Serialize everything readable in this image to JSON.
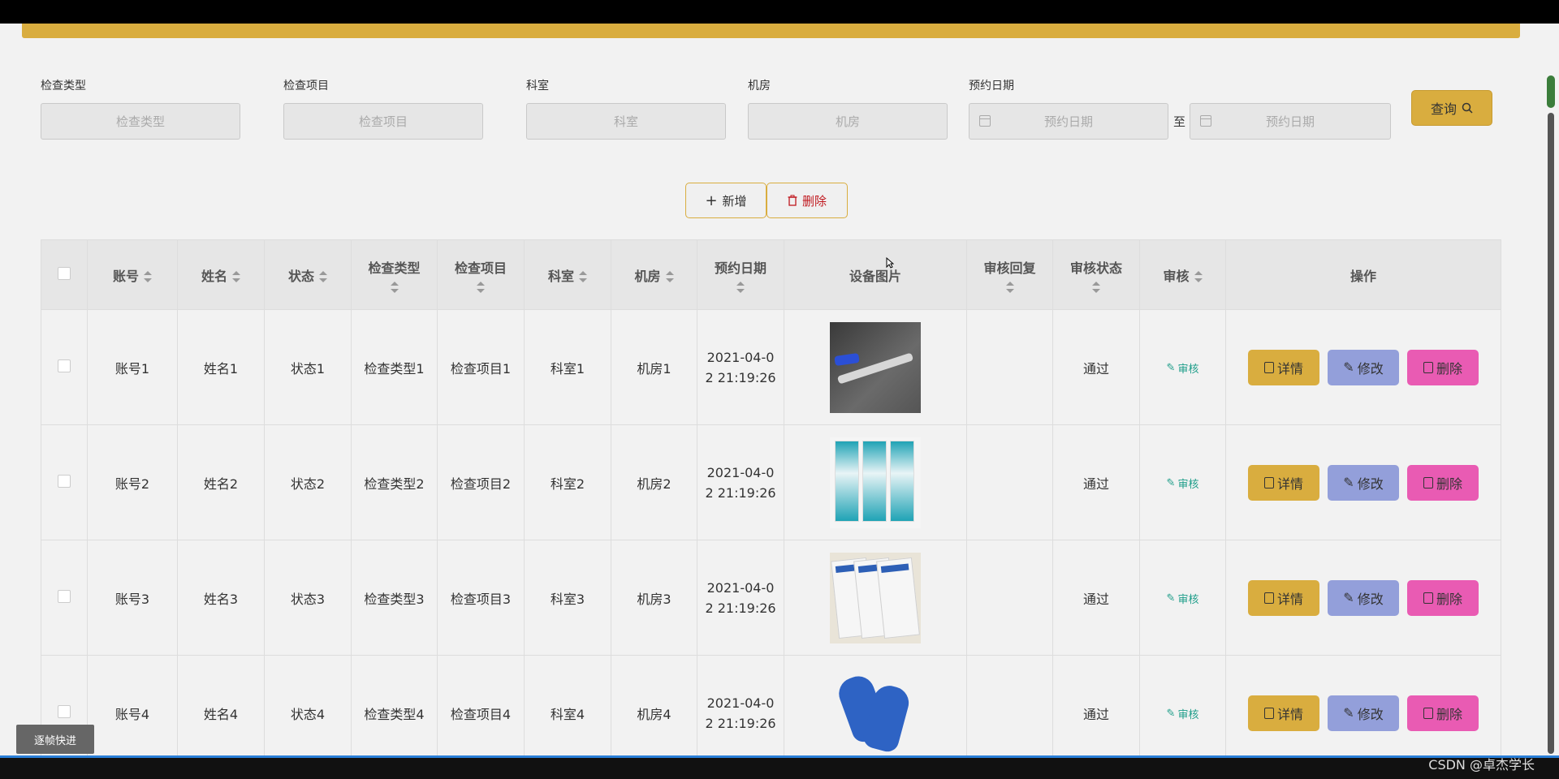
{
  "filters": [
    {
      "label": "检查类型",
      "placeholder": "检查类型"
    },
    {
      "label": "检查项目",
      "placeholder": "检查项目"
    },
    {
      "label": "科室",
      "placeholder": "科室"
    },
    {
      "label": "机房",
      "placeholder": "机房"
    }
  ],
  "date_filter": {
    "label": "预约日期",
    "start_placeholder": "预约日期",
    "separator": "至",
    "end_placeholder": "预约日期"
  },
  "buttons": {
    "query": "查询",
    "add": "新增",
    "delete": "删除"
  },
  "table": {
    "headers": [
      "账号",
      "姓名",
      "状态",
      "检查类型",
      "检查项目",
      "科室",
      "机房",
      "预约日期",
      "设备图片",
      "审核回复",
      "审核状态",
      "审核",
      "操作"
    ],
    "rows": [
      {
        "account": "账号1",
        "name": "姓名1",
        "status": "状态1",
        "type": "检查类型1",
        "item": "检查项目1",
        "dept": "科室1",
        "room": "机房1",
        "date_l1": "2021-04-0",
        "date_l2": "2 21:19:26",
        "reply": "",
        "audit_status": "通过",
        "audit_link": "审核"
      },
      {
        "account": "账号2",
        "name": "姓名2",
        "status": "状态2",
        "type": "检查类型2",
        "item": "检查项目2",
        "dept": "科室2",
        "room": "机房2",
        "date_l1": "2021-04-0",
        "date_l2": "2 21:19:26",
        "reply": "",
        "audit_status": "通过",
        "audit_link": "审核"
      },
      {
        "account": "账号3",
        "name": "姓名3",
        "status": "状态3",
        "type": "检查类型3",
        "item": "检查项目3",
        "dept": "科室3",
        "room": "机房3",
        "date_l1": "2021-04-0",
        "date_l2": "2 21:19:26",
        "reply": "",
        "audit_status": "通过",
        "audit_link": "审核"
      },
      {
        "account": "账号4",
        "name": "姓名4",
        "status": "状态4",
        "type": "检查类型4",
        "item": "检查项目4",
        "dept": "科室4",
        "room": "机房4",
        "date_l1": "2021-04-0",
        "date_l2": "2 21:19:26",
        "reply": "",
        "audit_status": "通过",
        "audit_link": "审核"
      }
    ],
    "row_actions": {
      "detail": "详情",
      "edit": "修改",
      "delete": "删除"
    }
  },
  "overlay": {
    "frame_button": "逐帧快进",
    "watermark": "CSDN @卓杰学长"
  },
  "colors": {
    "accent": "#d9ad3f",
    "edit": "#939fda",
    "danger": "#e95bb3",
    "audit_link": "#1f9e8a"
  }
}
